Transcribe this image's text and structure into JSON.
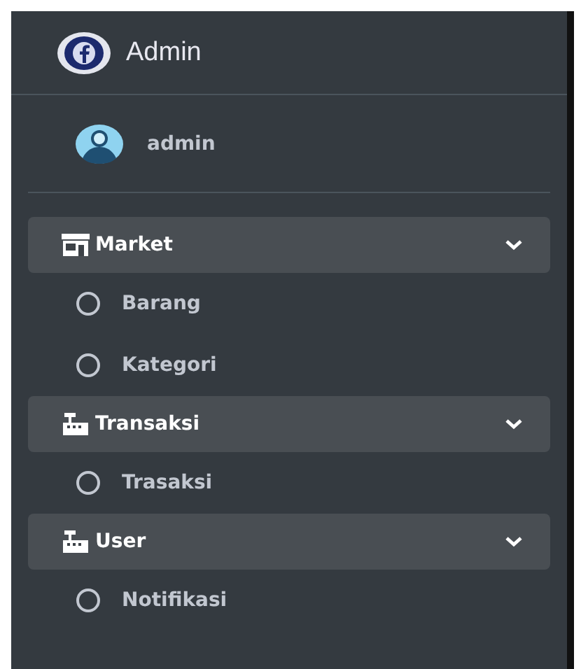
{
  "brand": {
    "title": "Admin"
  },
  "user": {
    "name": "admin"
  },
  "menu": [
    {
      "label": "Market",
      "expanded": true,
      "children": [
        {
          "label": "Barang"
        },
        {
          "label": "Kategori"
        }
      ]
    },
    {
      "label": "Transaksi",
      "expanded": true,
      "children": [
        {
          "label": "Trasaksi"
        }
      ]
    },
    {
      "label": "User",
      "expanded": true,
      "children": [
        {
          "label": "Notifikasi"
        }
      ]
    }
  ]
}
